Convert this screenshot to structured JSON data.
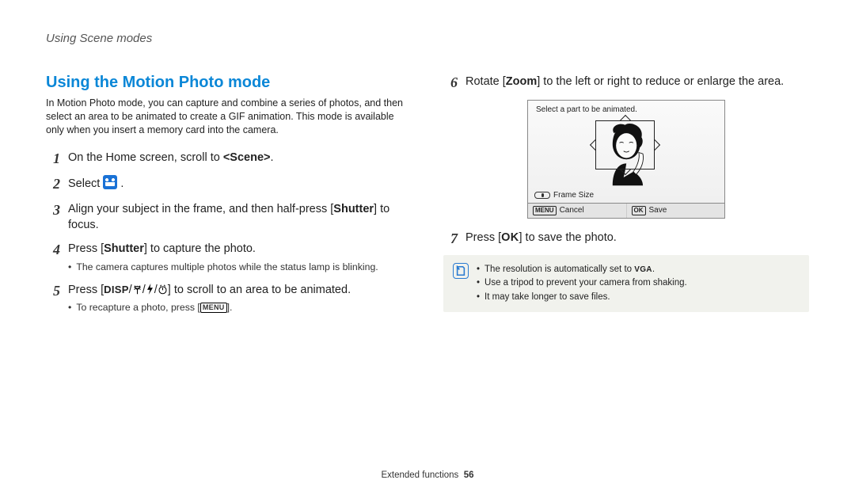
{
  "header": {
    "section": "Using Scene modes"
  },
  "title": "Using the Motion Photo mode",
  "intro": "In Motion Photo mode, you can capture and combine a series of photos, and then select an area to be animated to create a GIF animation. This mode is available only when you insert a memory card into the camera.",
  "steps_left": {
    "s1": {
      "num": "1",
      "a": "On the Home screen, scroll to ",
      "scene": "<Scene>",
      "b": "."
    },
    "s2": {
      "num": "2",
      "a": "Select ",
      "b": "."
    },
    "s3": {
      "num": "3",
      "a": "Align your subject in the frame, and then half-press [",
      "shutter": "Shutter",
      "b": "] to focus."
    },
    "s4": {
      "num": "4",
      "a": "Press [",
      "shutter": "Shutter",
      "b": "] to capture the photo.",
      "sub": "The camera captures multiple photos while the status lamp is blinking."
    },
    "s5": {
      "num": "5",
      "a": "Press [",
      "disp": "DISP",
      "sep": "/",
      "icon1": "macro-icon",
      "icon2": "flash-icon",
      "icon3": "timer-icon",
      "b": "] to scroll to an area to be animated.",
      "sub_a": "To recapture a photo, press [",
      "menu": "MENU",
      "sub_b": "]."
    }
  },
  "steps_right": {
    "s6": {
      "num": "6",
      "a": "Rotate [",
      "zoom": "Zoom",
      "b": "] to the left or right to reduce or enlarge the area."
    },
    "s7": {
      "num": "7",
      "a": "Press [",
      "ok": "OK",
      "b": "] to save the photo."
    }
  },
  "shot": {
    "title": "Select a part to be animated.",
    "legend": "Frame Size",
    "bar": {
      "menu": "MENU",
      "cancel": "Cancel",
      "ok": "OK",
      "save": "Save"
    }
  },
  "note": {
    "l1a": "The resolution is automatically set to ",
    "vga": "VGA",
    "l1b": ".",
    "l2": "Use a tripod to prevent your camera from shaking.",
    "l3": "It may take longer to save files."
  },
  "footer": {
    "chapter": "Extended functions",
    "page": "56"
  }
}
